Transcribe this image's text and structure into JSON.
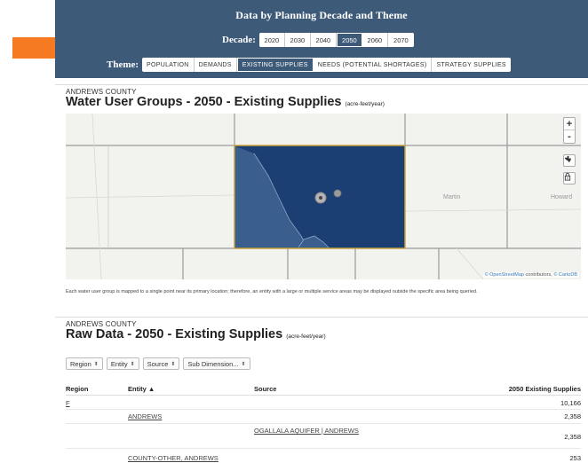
{
  "header": {
    "title": "Data by Planning Decade and Theme",
    "decade_label": "Decade:",
    "decades": [
      "2020",
      "2030",
      "2040",
      "2050",
      "2060",
      "2070"
    ],
    "selected_decade": "2050",
    "theme_label": "Theme:",
    "themes": [
      "POPULATION",
      "DEMANDS",
      "EXISTING SUPPLIES",
      "NEEDS (POTENTIAL SHORTAGES)",
      "STRATEGY SUPPLIES"
    ],
    "selected_theme": "EXISTING SUPPLIES"
  },
  "map_panel": {
    "county": "ANDREWS COUNTY",
    "title": "Water User Groups - 2050 - Existing Supplies",
    "unit": "(acre-feet/year)",
    "map_labels": [
      "Martin",
      "Howard"
    ],
    "zoom_in": "+",
    "zoom_out": "-",
    "attribution_link1": "© OpenStreetMap",
    "attribution_mid": " contributors, ",
    "attribution_link2": "© CartoDB",
    "note": "Each water user group is mapped to a single point near its primary location; therefore, an entity with a large or multiple service areas may be displayed outside the specific area being queried.",
    "colors": {
      "county_fill": "#1c3f73",
      "county_left": "#3a5f8f",
      "border": "#c8a43a"
    }
  },
  "raw_panel": {
    "county": "ANDREWS COUNTY",
    "title": "Raw Data - 2050 - Existing Supplies",
    "unit": "(acre-feet/year)",
    "filters": [
      "Region",
      "Entity",
      "Source",
      "Sub Dimension..."
    ],
    "columns": {
      "region": "Region",
      "entity": "Entity ▲",
      "source": "Source",
      "value": "2050 Existing Supplies"
    },
    "rows": [
      {
        "region": "F",
        "entity": "",
        "source": "",
        "value": "10,166"
      },
      {
        "region": "",
        "entity": "ANDREWS",
        "source": "",
        "value": "2,358"
      },
      {
        "region": "",
        "entity": "",
        "source": "OGALLALA AQUIFER | ANDREWS",
        "value": "2,358"
      },
      {
        "region": "",
        "entity": "COUNTY-OTHER, ANDREWS",
        "source": "",
        "value": "253"
      }
    ]
  }
}
